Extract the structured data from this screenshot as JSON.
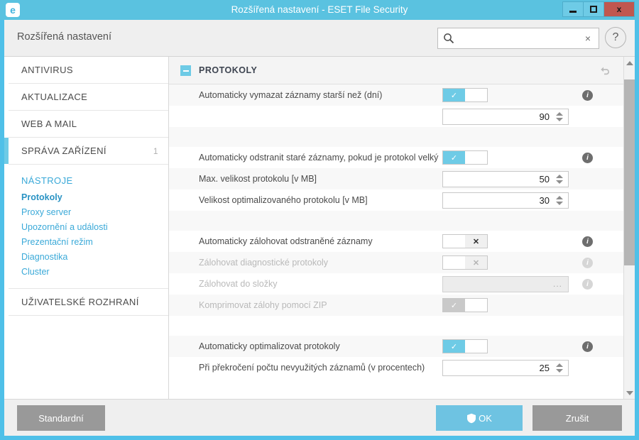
{
  "window": {
    "title": "Rozšířená nastavení - ESET File Security",
    "logo_letter": "e",
    "minimize_label": "minimize-icon",
    "maximize_label": "maximize-icon",
    "close_label": "x"
  },
  "header": {
    "title": "Rozšířená nastavení",
    "search_value": "",
    "search_placeholder": "",
    "clear_label": "×",
    "help_label": "?"
  },
  "sidebar": {
    "items": [
      {
        "label": "ANTIVIRUS",
        "badge": ""
      },
      {
        "label": "AKTUALIZACE",
        "badge": ""
      },
      {
        "label": "WEB A MAIL",
        "badge": ""
      },
      {
        "label": "SPRÁVA ZAŘÍZENÍ",
        "badge": "1"
      }
    ],
    "group": {
      "title": "NÁSTROJE",
      "subitems": [
        {
          "label": "Protokoly",
          "selected": true
        },
        {
          "label": "Proxy server",
          "selected": false
        },
        {
          "label": "Upozornění a události",
          "selected": false
        },
        {
          "label": "Prezentační režim",
          "selected": false
        },
        {
          "label": "Diagnostika",
          "selected": false
        },
        {
          "label": "Cluster",
          "selected": false
        }
      ]
    },
    "bottom_items": [
      {
        "label": "UŽIVATELSKÉ ROZHRANÍ",
        "badge": ""
      }
    ]
  },
  "content": {
    "section_title": "PROTOKOLY",
    "rows": [
      {
        "label": "Automaticky vymazat záznamy starší než (dní)",
        "control": "toggle",
        "state": "on",
        "disabled": false,
        "info": true
      },
      {
        "label": "",
        "control": "spinner",
        "value": "90",
        "disabled": false,
        "info": false
      },
      {
        "label": "",
        "control": "none",
        "disabled": false,
        "info": false
      },
      {
        "label": "Automaticky odstranit staré záznamy, pokud je protokol velký",
        "control": "toggle",
        "state": "on",
        "disabled": false,
        "info": true
      },
      {
        "label": "Max. velikost protokolu [v MB]",
        "control": "spinner",
        "value": "50",
        "disabled": false,
        "info": false
      },
      {
        "label": "Velikost optimalizovaného protokolu [v MB]",
        "control": "spinner",
        "value": "30",
        "disabled": false,
        "info": false
      },
      {
        "label": "",
        "control": "none",
        "disabled": false,
        "info": false
      },
      {
        "label": "Automaticky zálohovat odstraněné záznamy",
        "control": "toggle",
        "state": "off",
        "disabled": false,
        "info": true
      },
      {
        "label": "Zálohovat diagnostické protokoly",
        "control": "toggle",
        "state": "off",
        "disabled": true,
        "info": true
      },
      {
        "label": "Zálohovat do složky",
        "control": "browse",
        "value": "",
        "browse_label": "...",
        "disabled": true,
        "info": true
      },
      {
        "label": "Komprimovat zálohy pomocí ZIP",
        "control": "toggle",
        "state": "on",
        "disabled": true,
        "info": false
      },
      {
        "label": "",
        "control": "none",
        "disabled": false,
        "info": false
      },
      {
        "label": "Automaticky optimalizovat protokoly",
        "control": "toggle",
        "state": "on",
        "disabled": false,
        "info": true
      },
      {
        "label": "Při překročení počtu nevyužitých záznamů (v procentech)",
        "control": "spinner",
        "value": "25",
        "disabled": false,
        "info": false
      }
    ]
  },
  "footer": {
    "standard_label": "Standardní",
    "ok_label": "OK",
    "cancel_label": "Zrušit"
  },
  "colors": {
    "accent": "#6ecbe6",
    "titlebar": "#5ac2e0",
    "close": "#c0574f",
    "link": "#3aa9d8",
    "button_gray": "#999999"
  }
}
